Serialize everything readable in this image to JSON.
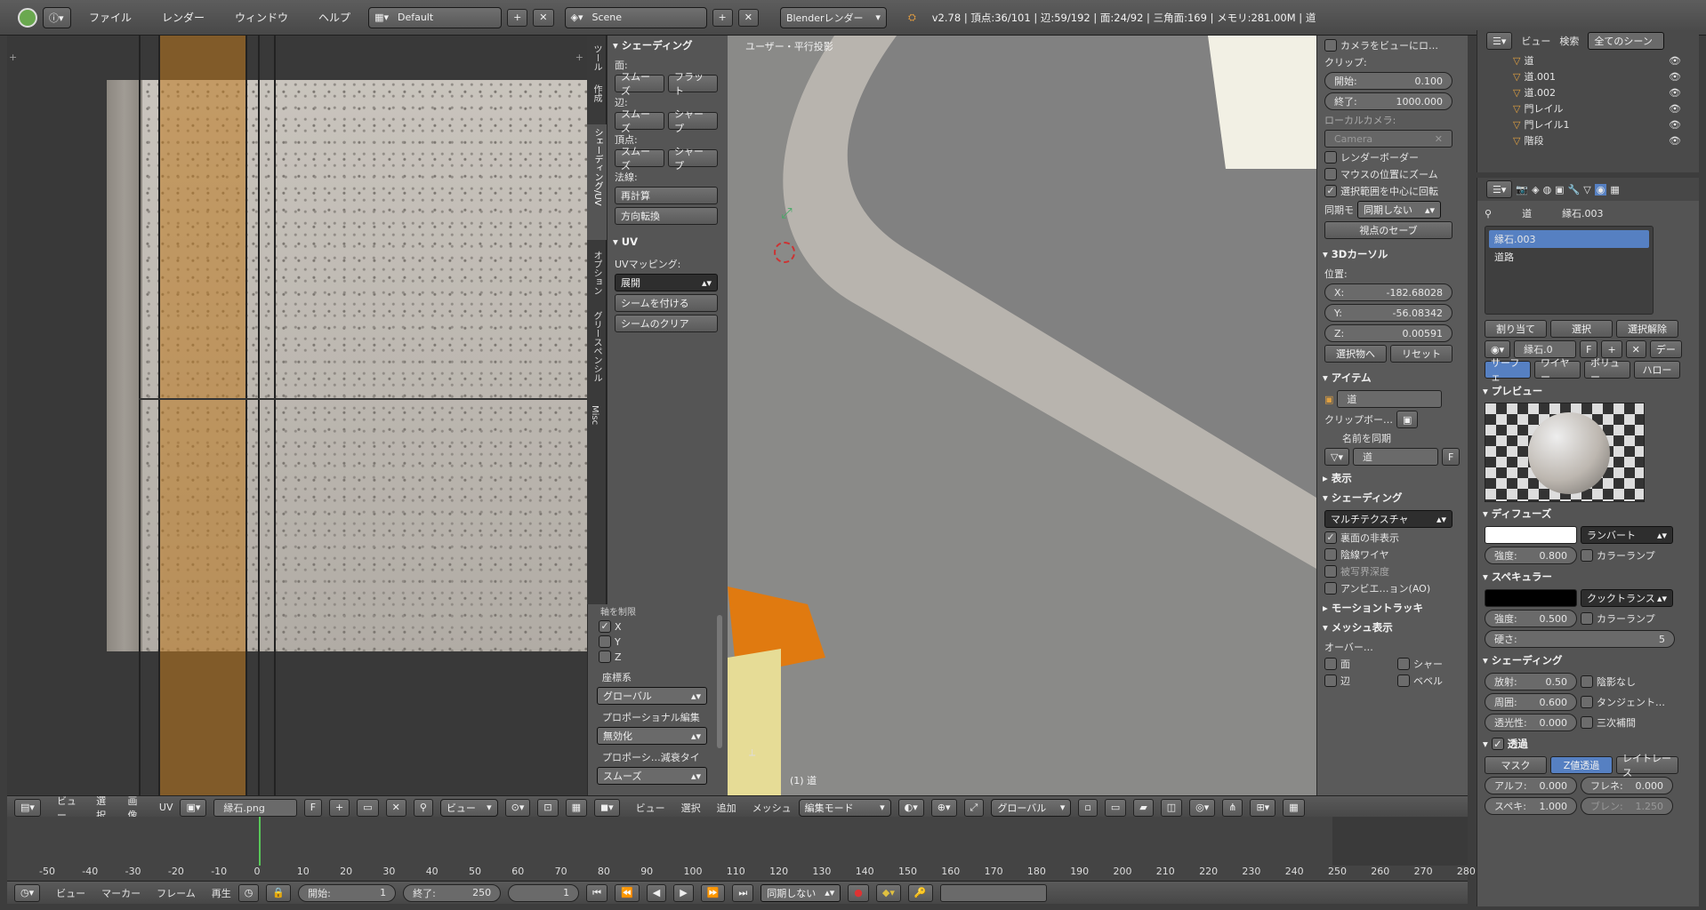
{
  "topbar": {
    "menus": [
      "ファイル",
      "レンダー",
      "ウィンドウ",
      "ヘルプ"
    ],
    "layout": "Default",
    "scene": "Scene",
    "engine": "Blenderレンダー",
    "stats": "v2.78 | 頂点:36/101 | 辺:59/192 | 面:24/92 | 三角面:169 | メモリ:281.00M | 道"
  },
  "uv_header": {
    "menus": [
      "ビュー",
      "選択",
      "画像",
      "UV"
    ],
    "image": "縁石.png",
    "image_flag": "F",
    "view": "ビュー"
  },
  "tools": {
    "tabs": [
      "ツール",
      "作成",
      "シェーディング/UV",
      "オプション",
      "グリースペンシル",
      "Misc"
    ],
    "shading_title": "シェーディング",
    "face": "面:",
    "smooth": "スムーズ",
    "flat": "フラット",
    "edge": "辺:",
    "sharp": "シャープ",
    "vertex": "頂点:",
    "normals": "法線:",
    "recalc": "再計算",
    "flip": "方向転換",
    "uv_title": "UV",
    "uv_mapping": "UVマッピング:",
    "unwrap": "展開",
    "mark_seam": "シームを付ける",
    "clear_seam": "シームのクリア",
    "axis_title": "軸を制限",
    "axes": [
      "X",
      "Y",
      "Z"
    ],
    "coord_label": "座標系",
    "coord": "グローバル",
    "prop_label": "プロポーショナル編集",
    "prop": "無効化",
    "falloff_label": "プロポーシ…減衰タイ",
    "falloff": "スムーズ"
  },
  "viewport": {
    "label": "ユーザー・平行投影",
    "obj_label": "(1) 道",
    "header": [
      "ビュー",
      "選択",
      "追加",
      "メッシュ"
    ],
    "mode": "編集モード",
    "orient": "グローバル"
  },
  "n_panel": {
    "lock_camera": "カメラをビューにロ…",
    "clip": "クリップ:",
    "start_label": "開始:",
    "start": "0.100",
    "end_label": "終了:",
    "end": "1000.000",
    "local_cam": "ローカルカメラ:",
    "camera": "Camera",
    "render_border": "レンダーボーダー",
    "zoom_mouse": "マウスの位置にズーム",
    "rotate_sel": "選択範囲を中心に回転",
    "sync_label": "同期モ",
    "sync": "同期しない",
    "save_view": "視点のセーブ",
    "cursor_title": "3Dカーソル",
    "position": "位置:",
    "x": "-182.68028",
    "y": "-56.08342",
    "z": "0.00591",
    "to_selected": "選択物へ",
    "reset": "リセット",
    "item_title": "アイテム",
    "item_name": "道",
    "clip_border": "クリップボー…",
    "sync_name": "名前を同期",
    "mesh_name": "道",
    "mesh_flag": "F",
    "display_title": "表示",
    "shading_title": "シェーディング",
    "multitex": "マルチテクスチャ",
    "backface": "裏面の非表示",
    "hidden_wire": "陰線ワイヤ",
    "dof": "被写界深度",
    "ao": "アンビエ…ョン(AO)",
    "motion": "モーショントラッキ",
    "mesh_display": "メッシュ表示",
    "overlay": "オーバー…",
    "face": "面",
    "edge": "辺",
    "crease": "シャー",
    "bevel": "ベベル"
  },
  "outliner": {
    "view": "ビュー",
    "search": "検索",
    "scope": "全てのシーン",
    "items": [
      "道",
      "道.001",
      "道.002",
      "門レイル",
      "門レイル1",
      "階段"
    ]
  },
  "props": {
    "breadcrumb_obj": "道",
    "breadcrumb_mat": "縁石.003",
    "slots": [
      "縁石.003",
      "道路"
    ],
    "assign": "割り当て",
    "select": "選択",
    "deselect": "選択解除",
    "mat_name": "縁石.0",
    "mat_flag": "F",
    "data": "デー",
    "tabs": [
      "サーフェ",
      "ワイヤー",
      "ボリュー",
      "ハロー"
    ],
    "preview": "プレビュー",
    "diffuse": "ディフューズ",
    "lambert": "ランバート",
    "intensity_label": "強度:",
    "diff_intensity": "0.800",
    "ramp": "カラーランプ",
    "specular": "スペキュラー",
    "cooktorr": "クックトランス",
    "spec_intensity": "0.500",
    "hardness_label": "硬さ:",
    "hardness": "5",
    "shading": "シェーディング",
    "emit_label": "放射:",
    "emit": "0.50",
    "ambient_label": "周囲:",
    "ambient": "0.600",
    "translucency_label": "透光性:",
    "translucency": "0.000",
    "shadeless": "陰影なし",
    "tangent": "タンジェント…",
    "cubic": "三次補間",
    "transparency": "透過",
    "mask": "マスク",
    "ztrans": "Z値透過",
    "raytrace": "レイトレース",
    "alpha_label": "アルフ:",
    "alpha": "0.000",
    "fresnel_label": "フレネ:",
    "fresnel": "0.000",
    "spec_label": "スペキ:",
    "spec": "1.000",
    "blend_label": "ブレン:",
    "blend": "1.250"
  },
  "timeline": {
    "ticks": [
      "-50",
      "-40",
      "-30",
      "-20",
      "-10",
      "0",
      "10",
      "20",
      "30",
      "40",
      "50",
      "60",
      "70",
      "80",
      "90",
      "100",
      "110",
      "120",
      "130",
      "140",
      "150",
      "160",
      "170",
      "180",
      "190",
      "200",
      "210",
      "220",
      "230",
      "240",
      "250",
      "260",
      "270",
      "280"
    ],
    "menus": [
      "ビュー",
      "マーカー",
      "フレーム",
      "再生"
    ],
    "start_label": "開始:",
    "start": "1",
    "end_label": "終了:",
    "end": "250",
    "current": "1",
    "sync": "同期しない"
  }
}
